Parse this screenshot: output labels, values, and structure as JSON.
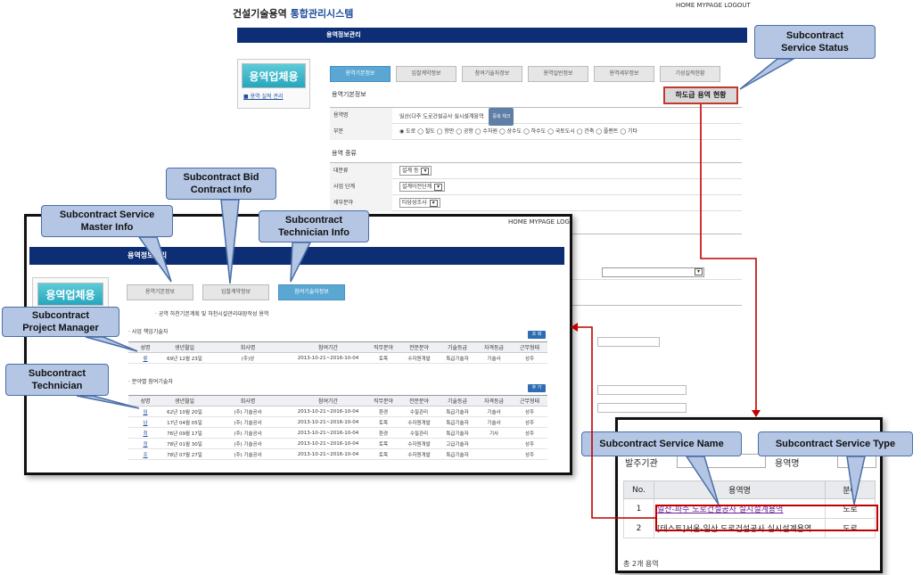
{
  "bg": {
    "brand_prefix": "건설기술용역",
    "brand_suffix": "통합관리시스템",
    "toplinks": "HOME MYPAGE LOGOUT",
    "nav_title": "용역정보관리",
    "side_banner": "용역업체용",
    "side_link": "■ 용역 실적 관리",
    "tabs": [
      "용역기본정보",
      "입찰계약정보",
      "참여기술자정보",
      "용역일반정보",
      "용역세부정보",
      "기성실적현황"
    ],
    "section_master": "용역기본정보",
    "section_kind": "용역 종류",
    "form": {
      "service_name_label": "용역명",
      "service_name_value": "일산(다주 도로건설공사 실시설계용역",
      "check_btn": "중복 체크",
      "type_label": "부문",
      "type_options": "◉ 도로 ◯ 철도 ◯ 항만 ◯ 공항 ◯ 수자원 ◯ 상수도 ◯ 하수도 ◯ 국토도시 ◯ 건축 ◯ 플랜트 ◯ 기타",
      "cat1_label": "대분류",
      "cat1_value": "설계 등",
      "cat2_label": "사업 단계",
      "cat2_value": "설계이전단계",
      "cat3_label": "세부분야",
      "cat3_value": "타당성조사"
    },
    "status_button": "하도급 용역 현황"
  },
  "fg": {
    "toplinks": "HOME MYPAGE LOGOUT",
    "nav_title": "용역정보관리",
    "side_banner": "용역업체용",
    "tabs": [
      "용역기본정보",
      "입찰계약정보",
      "참여기술자정보"
    ],
    "note": "· 공역 하천기본계획 및 하천시설관리대장작성 용역",
    "pm_title": "· 사업 책임기술자",
    "pm_btn": "조 회",
    "tech_title": "· 분야별 참여기술자",
    "tech_btn": "추 가",
    "columns": [
      "성명",
      "생년월일",
      "회사명",
      "참여기간",
      "직무분야",
      "전문분야",
      "기술등급",
      "자격등급",
      "근무형태"
    ],
    "pm_rows": [
      [
        "류",
        "69년 12월 23일",
        "(주)상",
        "2013-10-21~2016-10-04",
        "토목",
        "수자원개발",
        "특급기술자",
        "기술사",
        "상주"
      ]
    ],
    "tech_rows": [
      [
        "임",
        "62년 10월 20일",
        "(주)   기술공사",
        "2013-10-21~2016-10-04",
        "환경",
        "수질관리",
        "특급기술자",
        "기술사",
        "상주"
      ],
      [
        "남",
        "17년 04월 05일",
        "(주)   기술공사",
        "2013-10-21~2016-10-04",
        "토목",
        "수자원개발",
        "특급기술자",
        "기술사",
        "상주"
      ],
      [
        "최",
        "76년 09월 17일",
        "(주)   기술공사",
        "2013-10-21~2016-10-04",
        "환경",
        "수질관리",
        "특급기술자",
        "기사",
        "상주"
      ],
      [
        "정",
        "78년 01월 30일",
        "(주)   기술공사",
        "2013-10-21~2016-10-04",
        "토목",
        "수자원개발",
        "고급기술자",
        "",
        "상주"
      ],
      [
        "조",
        "78년 07월 27일",
        "(주)   기술공사",
        "2013-10-21~2016-10-04",
        "토목",
        "수자원개발",
        "특급기술자",
        "",
        "상주"
      ]
    ]
  },
  "br": {
    "org_label": "발주기관",
    "name_label": "용역명",
    "columns": [
      "No.",
      "용역명",
      "분야"
    ],
    "rows": [
      {
        "no": "1",
        "name": "일산-파주 도로건설공사 실시설계용역",
        "type": "도로"
      },
      {
        "no": "2",
        "name": "[테스트]서울-일산 도로건설공사 실시설계용역",
        "type": "도로"
      }
    ],
    "total": "총 2개 용역"
  },
  "callouts": {
    "status": "Subcontract\nService Status",
    "bid": "Subcontract Bid\nContract Info",
    "master": "Subcontract Service\nMaster Info",
    "technician_info": "Subcontract\nTechnician Info",
    "pm": "Subcontract\nProject Manager",
    "technician": "Subcontract\nTechnician",
    "service_name": "Subcontract Service Name",
    "service_type": "Subcontract Service Type"
  },
  "colors": {
    "nav": "#0d2e75",
    "callout_fill": "#b4c6e4",
    "callout_border": "#4a6fa8",
    "highlight_red": "#c00000"
  }
}
